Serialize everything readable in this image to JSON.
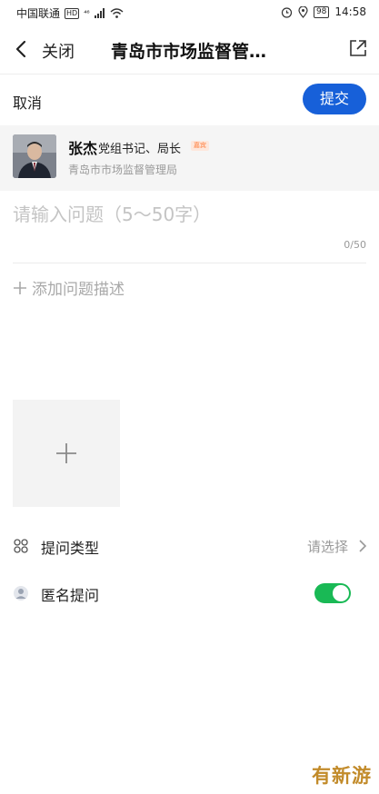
{
  "status_bar": {
    "carrier": "中国联通",
    "hd_badge": "HD",
    "signal_badge": "⁴⁶",
    "battery": "98",
    "time": "14:58"
  },
  "nav": {
    "close_label": "关闭",
    "title": "青岛市市场监督管理局"
  },
  "actions": {
    "cancel_label": "取消",
    "submit_label": "提交"
  },
  "profile": {
    "name": "张杰",
    "role": "党组书记、局长",
    "badge": "嘉宾",
    "organization": "青岛市市场监督管理局"
  },
  "question": {
    "placeholder": "请输入问题（5～50字）",
    "counter": "0/50"
  },
  "description": {
    "add_label": "添加问题描述"
  },
  "settings": {
    "type_label": "提问类型",
    "type_value": "请选择",
    "anonymous_label": "匿名提问",
    "anonymous_on": true
  },
  "watermark": "有新游",
  "colors": {
    "accent": "#1760d9",
    "toggle_on": "#19b955",
    "watermark": "#c28b2a"
  }
}
